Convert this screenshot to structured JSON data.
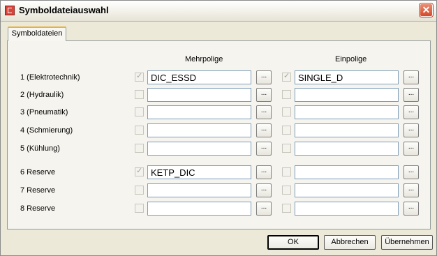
{
  "window": {
    "title": "Symboldateiauswahl",
    "close_glyph": "✕"
  },
  "tab": {
    "label": "Symboldateien"
  },
  "columns": {
    "multi": "Mehrpolige",
    "single": "Einpolige"
  },
  "browse_label": "...",
  "rows": [
    {
      "label": "1 (Elektrotechnik)",
      "multi_checked": true,
      "multi_value": "DIC_ESSD",
      "single_checked": true,
      "single_value": "SINGLE_D"
    },
    {
      "label": "2 (Hydraulik)",
      "multi_checked": false,
      "multi_value": "",
      "single_checked": false,
      "single_value": ""
    },
    {
      "label": "3 (Pneumatik)",
      "multi_checked": false,
      "multi_value": "",
      "single_checked": false,
      "single_value": ""
    },
    {
      "label": "4 (Schmierung)",
      "multi_checked": false,
      "multi_value": "",
      "single_checked": false,
      "single_value": ""
    },
    {
      "label": "5 (Kühlung)",
      "multi_checked": false,
      "multi_value": "",
      "single_checked": false,
      "single_value": ""
    },
    {
      "label": "6 Reserve",
      "multi_checked": true,
      "multi_value": "KETP_DIC",
      "single_checked": false,
      "single_value": ""
    },
    {
      "label": "7 Reserve",
      "multi_checked": false,
      "multi_value": "",
      "single_checked": false,
      "single_value": ""
    },
    {
      "label": "8 Reserve",
      "multi_checked": false,
      "multi_value": "",
      "single_checked": false,
      "single_value": ""
    }
  ],
  "buttons": {
    "ok": "OK",
    "cancel": "Abbrechen",
    "apply": "Übernehmen"
  }
}
